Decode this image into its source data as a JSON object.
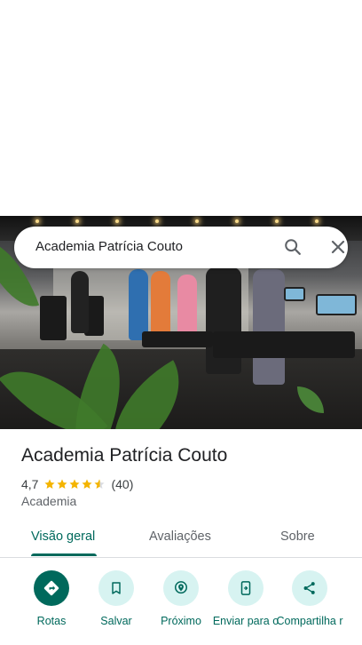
{
  "search": {
    "query": "Academia Patrícia Couto"
  },
  "place": {
    "title": "Academia Patrícia Couto",
    "rating": "4,7",
    "rating_value": 4.7,
    "reviews_count": "(40)",
    "category": "Academia"
  },
  "tabs": [
    {
      "label": "Visão geral",
      "active": true
    },
    {
      "label": "Avaliações",
      "active": false
    },
    {
      "label": "Sobre",
      "active": false
    }
  ],
  "actions": [
    {
      "label": "Rotas",
      "icon": "directions-icon"
    },
    {
      "label": "Salvar",
      "icon": "bookmark-icon"
    },
    {
      "label": "Próximo",
      "icon": "nearby-icon"
    },
    {
      "label": "Enviar para o",
      "icon": "send-to-phone-icon"
    },
    {
      "label": "Compartilha r",
      "icon": "share-icon"
    }
  ],
  "colors": {
    "accent": "#00695c",
    "action_bg": "#d7f3f1",
    "star": "#f4b400"
  }
}
